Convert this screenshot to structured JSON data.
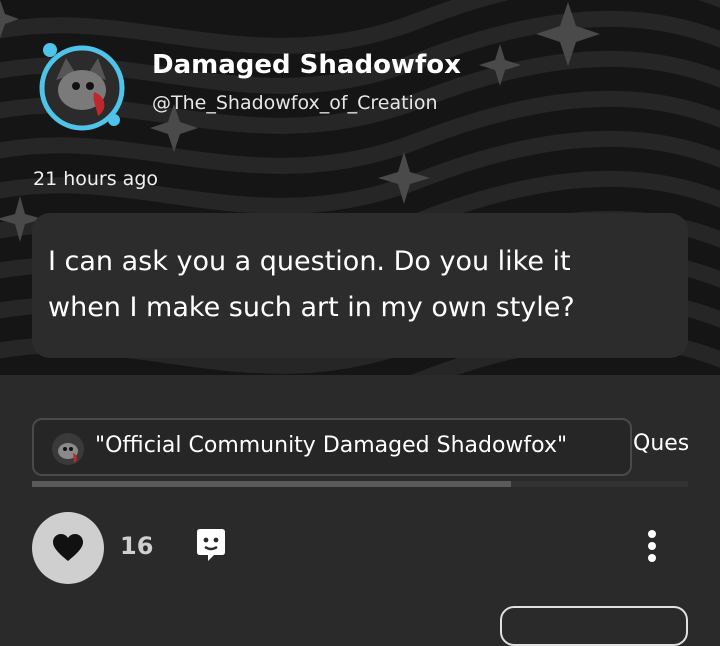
{
  "profile": {
    "display_name": "Damaged Shadowfox",
    "handle": "@The_Shadowfox_of_Creation",
    "avatar_icon": "fox-avatar-icon"
  },
  "post": {
    "timestamp": "21 hours ago",
    "message": "I can ask you a question. Do you like it\nwhen I make such art in my own style?"
  },
  "tags": {
    "items": [
      {
        "label": "\"Official Community Damaged Shadowfox\""
      },
      {
        "label": "Ques"
      }
    ],
    "scroll_fraction_visible": 0.73
  },
  "actions": {
    "like_count": "16",
    "like_icon": "heart-icon",
    "comment_icon": "comment-icon",
    "more_icon": "more-vertical-icon"
  },
  "colors": {
    "background": "#2a2a2a",
    "header_background": "#151515",
    "bubble": "#2c2c2c",
    "like_button": "#cfcfcf"
  }
}
